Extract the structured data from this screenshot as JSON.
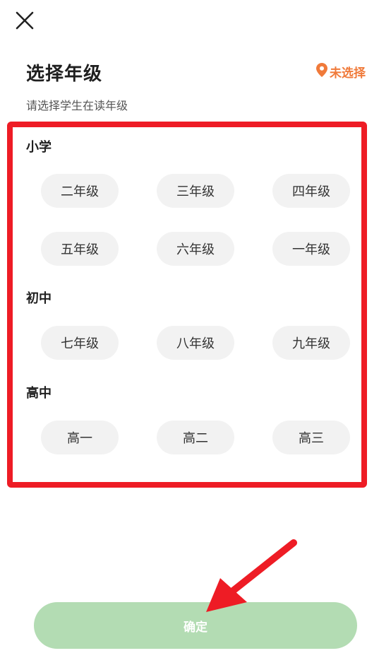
{
  "header": {
    "title": "选择年级",
    "location_label": "未选择",
    "subtitle": "请选择学生在读年级"
  },
  "sections": [
    {
      "label": "小学",
      "chips": [
        "二年级",
        "三年级",
        "四年级",
        "五年级",
        "六年级",
        "一年级"
      ]
    },
    {
      "label": "初中",
      "chips": [
        "七年级",
        "八年级",
        "九年级"
      ]
    },
    {
      "label": "高中",
      "chips": [
        "高一",
        "高二",
        "高三"
      ]
    }
  ],
  "footer": {
    "confirm_label": "确定"
  },
  "colors": {
    "accent_orange": "#f07a3a",
    "confirm_green": "#b3dcb3",
    "annotation_red": "#ee1c25",
    "chip_bg": "#f2f2f2"
  }
}
